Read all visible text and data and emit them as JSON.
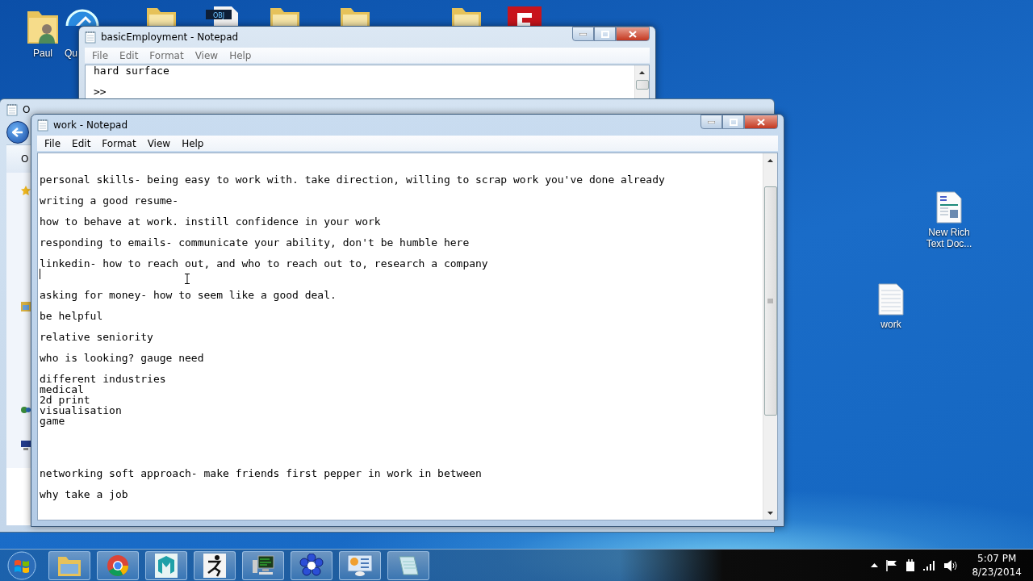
{
  "desktop_icons": [
    {
      "kind": "user-folder",
      "label": "Paul"
    },
    {
      "kind": "app",
      "label": "Qu"
    },
    {
      "kind": "folder"
    },
    {
      "kind": "obj-file",
      "badge": "OBJ"
    },
    {
      "kind": "folder"
    },
    {
      "kind": "folder"
    },
    {
      "kind": "folder"
    },
    {
      "kind": "red-app"
    },
    {
      "kind": "rich-text",
      "label": "New Rich Text Doc..."
    },
    {
      "kind": "text-file",
      "label": "work"
    }
  ],
  "background_notepad": {
    "title": "basicEmployment - Notepad",
    "menu": [
      "File",
      "Edit",
      "Format",
      "View",
      "Help"
    ],
    "lines": [
      "hard surface",
      ">>"
    ]
  },
  "explorer_window": {
    "title": "O",
    "toolbar_label": "O"
  },
  "notepad": {
    "title": "work - Notepad",
    "menu": [
      "File",
      "Edit",
      "Format",
      "View",
      "Help"
    ],
    "text_before_caret": "personal skills- being easy to work with. take direction, willing to scrap work you've done already\n\nwriting a good resume-\n\nhow to behave at work. instill confidence in your work\n\nresponding to emails- communicate your ability, don't be humble here\n\nlinkedin- how to reach out, and who to reach out to, research a company",
    "text_after_caret": "\nasking for money- how to seem like a good deal.\n\nbe helpful\n\nrelative seniority\n\nwho is looking? gauge need\n\ndifferent industries\nmedical\n2d print\nvisualisation\ngame\n\n\n\n\nnetworking soft approach- make friends first pepper in work in between\n\nwhy take a job"
  },
  "taskbar": {
    "apps": [
      {
        "kind": "explorer"
      },
      {
        "kind": "browser"
      },
      {
        "kind": "maya"
      },
      {
        "kind": "figure"
      },
      {
        "kind": "monitor"
      },
      {
        "kind": "flower"
      },
      {
        "kind": "panel"
      },
      {
        "kind": "notepad"
      }
    ],
    "clock": {
      "time": "5:07 PM",
      "date": "8/23/2014"
    }
  }
}
